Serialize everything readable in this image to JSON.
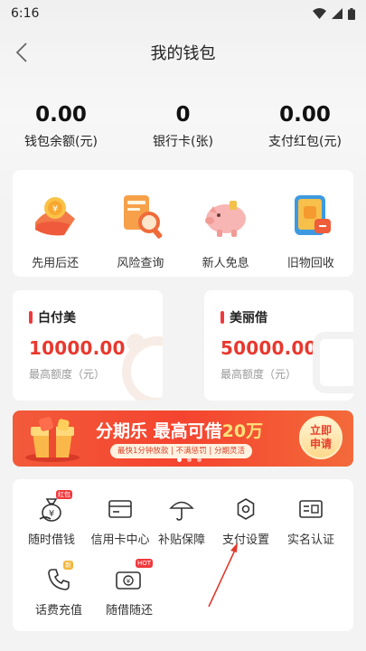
{
  "status_bar": {
    "time": "6:16"
  },
  "nav": {
    "title": "我的钱包"
  },
  "stats": [
    {
      "value": "0.00",
      "label": "钱包余额(元)"
    },
    {
      "value": "0",
      "label": "银行卡(张)"
    },
    {
      "value": "0.00",
      "label": "支付红包(元)"
    }
  ],
  "quick_actions": [
    {
      "label": "先用后还",
      "icon": "coin-hand-icon"
    },
    {
      "label": "风险查询",
      "icon": "magnifier-doc-icon"
    },
    {
      "label": "新人免息",
      "icon": "piggy-bank-icon"
    },
    {
      "label": "旧物回收",
      "icon": "phone-recycle-icon"
    }
  ],
  "loans": [
    {
      "title": "白付美",
      "amount": "10000.00",
      "sub": "最高额度（元）"
    },
    {
      "title": "美丽借",
      "amount": "50000.00",
      "sub": "最高额度（元）"
    }
  ],
  "banner": {
    "title_a": "分期乐  最高可借",
    "title_b": "20万",
    "sub": "最快1分钟放款 | 不满惩罚 | 分期灵活",
    "btn_line1": "立即",
    "btn_line2": "申请"
  },
  "services": [
    {
      "label": "随时借钱",
      "icon": "money-bag-icon",
      "badge": "红包"
    },
    {
      "label": "信用卡中心",
      "icon": "credit-card-icon"
    },
    {
      "label": "补贴保障",
      "icon": "umbrella-icon"
    },
    {
      "label": "支付设置",
      "icon": "gear-icon"
    },
    {
      "label": "实名认证",
      "icon": "id-card-icon"
    },
    {
      "label": "话费充值",
      "icon": "phone-call-icon",
      "badge": "新"
    },
    {
      "label": "随借随还",
      "icon": "wallet-cash-icon",
      "badge": "HOT"
    }
  ],
  "colors": {
    "accent": "#e8382e",
    "banner": "#f4442f"
  }
}
